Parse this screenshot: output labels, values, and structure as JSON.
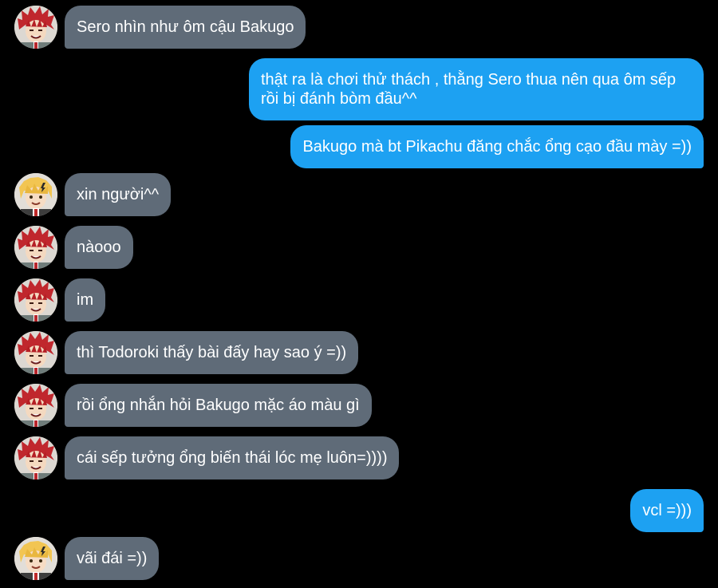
{
  "colors": {
    "background": "#000000",
    "incoming_bubble": "#5f6b78",
    "outgoing_bubble": "#1da1f2",
    "text": "#ffffff"
  },
  "avatars": {
    "red_hair": "avatar-red-spiky-hair",
    "blonde_hair": "avatar-blonde-hair"
  },
  "messages": [
    {
      "side": "in",
      "avatar": "red_hair",
      "text": "Sero nhìn như ôm cậu Bakugo"
    },
    {
      "side": "out",
      "text": "thật ra là chơi thử thách , thằng Sero thua nên qua ôm sếp rồi bị đánh bòm đầu^^"
    },
    {
      "side": "out",
      "text": "Bakugo mà bt Pikachu đăng chắc ổng cạo đầu mày =))"
    },
    {
      "side": "in",
      "avatar": "blonde_hair",
      "text": "xin người^^"
    },
    {
      "side": "in",
      "avatar": "red_hair",
      "text": "nàooo"
    },
    {
      "side": "in",
      "avatar": "red_hair",
      "text": "im"
    },
    {
      "side": "in",
      "avatar": "red_hair",
      "text": "thì Todoroki thấy bài đấy hay sao ý =))"
    },
    {
      "side": "in",
      "avatar": "red_hair",
      "text": "rồi ổng nhắn hỏi Bakugo mặc áo màu gì"
    },
    {
      "side": "in",
      "avatar": "red_hair",
      "text": "cái sếp tưởng ổng biến thái lóc mẹ luôn=))))"
    },
    {
      "side": "out",
      "text": "vcl =)))"
    },
    {
      "side": "in",
      "avatar": "blonde_hair",
      "text": "vãi đái =))"
    }
  ]
}
